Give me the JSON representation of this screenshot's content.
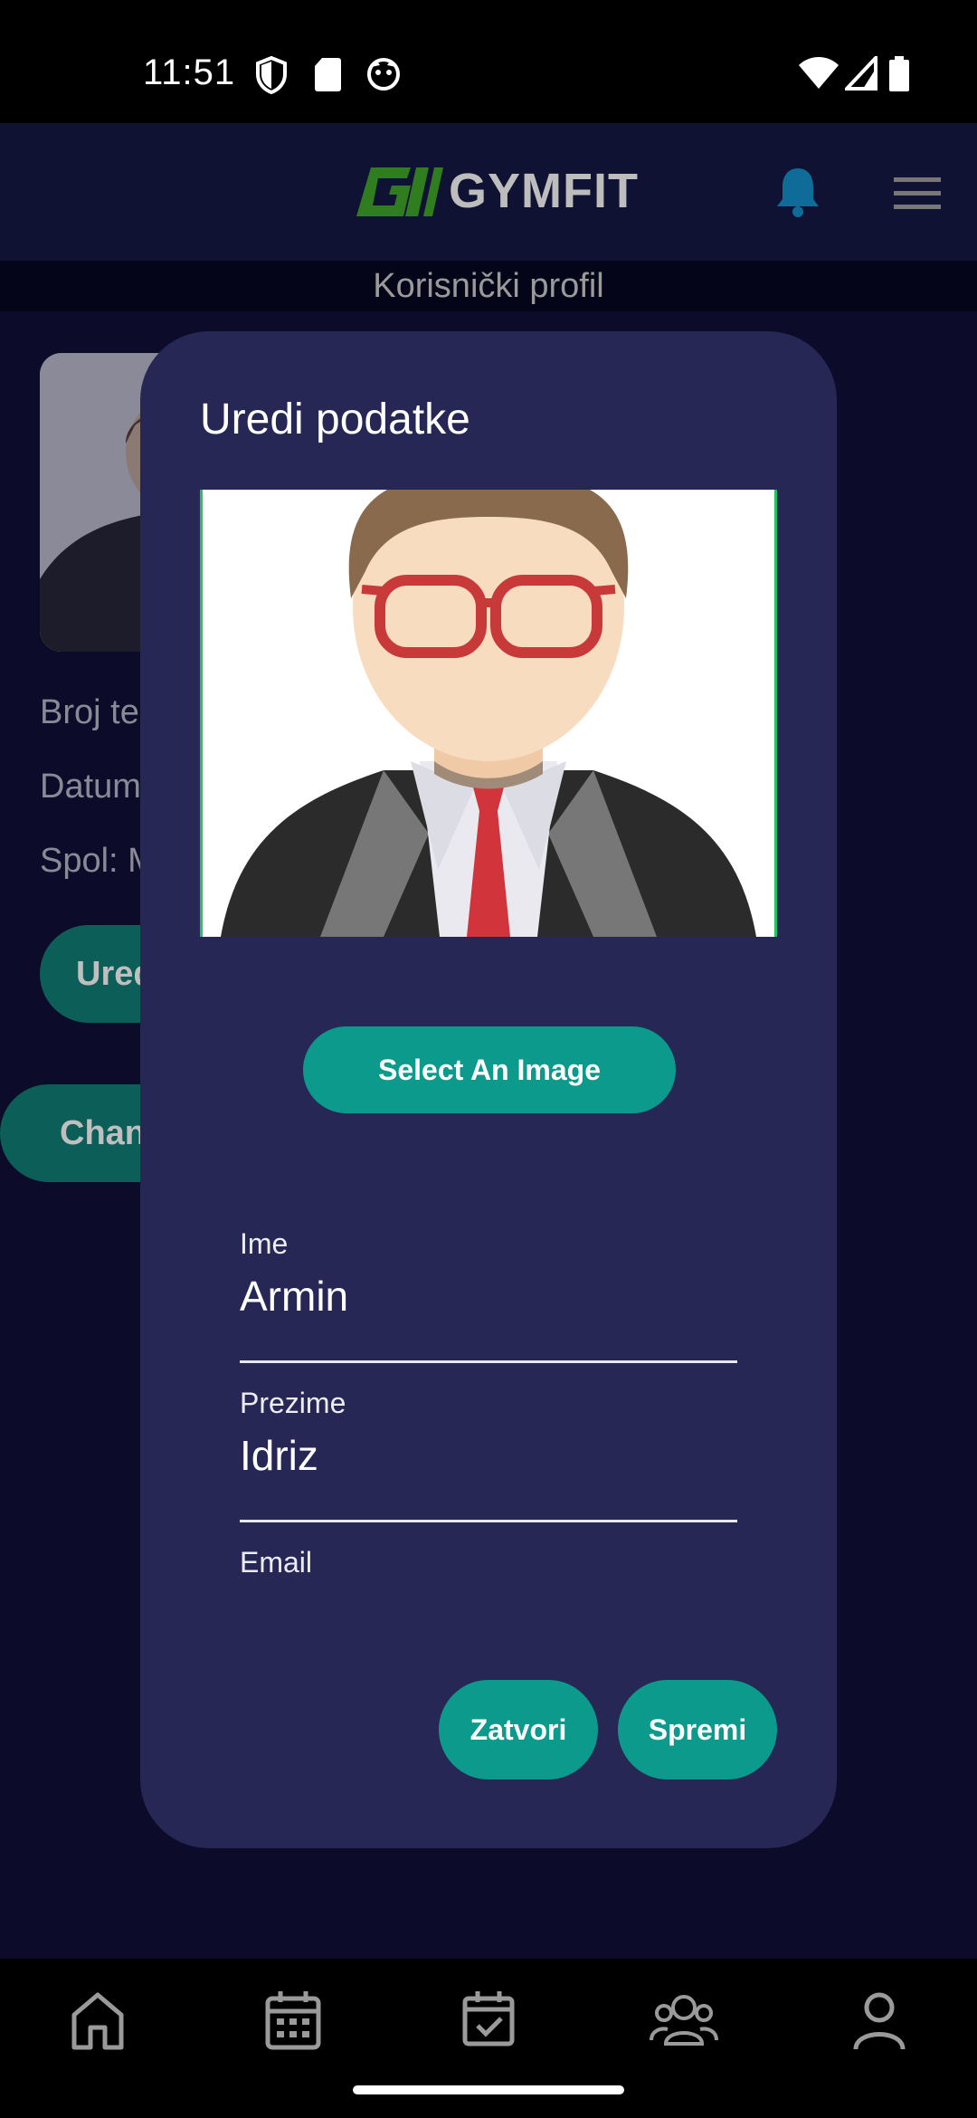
{
  "status_bar": {
    "time": "11:51",
    "icons": [
      "shield-icon",
      "sd-card-icon",
      "face-icon",
      "wifi-icon",
      "signal-icon",
      "battery-icon"
    ]
  },
  "header": {
    "logo_text": "GYMFIT",
    "logo_mark": "GI",
    "icons": [
      "bell-icon",
      "hamburger-menu-icon"
    ],
    "accent_color": "#0f7aa8"
  },
  "subheader": {
    "title": "Korisnički profil"
  },
  "background_profile": {
    "partial_texts": [
      "Broj te",
      "Datum",
      "Spol: M"
    ],
    "partial_buttons": [
      "Ured",
      "Chan"
    ]
  },
  "dialog": {
    "title": "Uredi podatke",
    "select_image_label": "Select An Image",
    "fields": {
      "first_name": {
        "label": "Ime",
        "value": "Armin"
      },
      "last_name": {
        "label": "Prezime",
        "value": "Idriz"
      },
      "email": {
        "label": "Email",
        "value": ""
      }
    },
    "close_label": "Zatvori",
    "save_label": "Spremi",
    "button_color": "#0b9a8c",
    "background_color": "#262754"
  },
  "bottom_nav": {
    "items": [
      "home-icon",
      "calendar-icon",
      "calendar-check-icon",
      "group-icon",
      "person-icon"
    ]
  }
}
